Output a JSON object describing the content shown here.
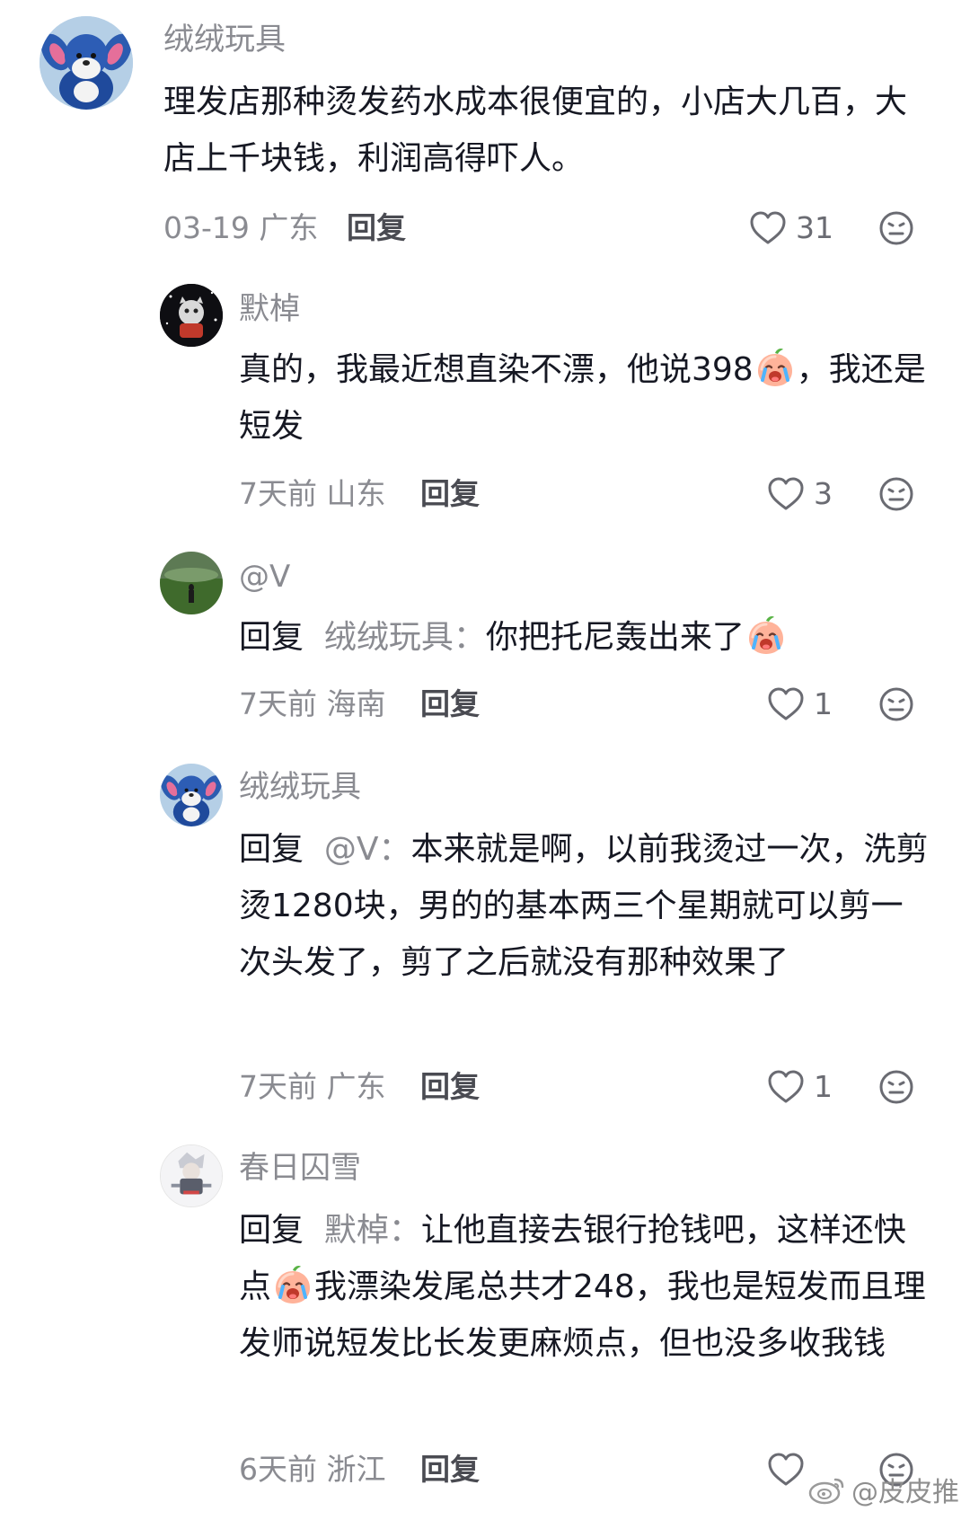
{
  "comments": [
    {
      "user": "绒绒玩具",
      "text": "理发店那种烫发药水成本很便宜的，小店大几百，大店上千块钱，利润高得吓人。",
      "time": "03-19 广东",
      "reply_label": "回复",
      "likes": "31"
    },
    {
      "user": "默棹",
      "text_a": "真的，我最近想直染不漂，他说398",
      "text_b": "，我还是短发",
      "time": "7天前 山东",
      "reply_label": "回复",
      "likes": "3"
    },
    {
      "user": "@V",
      "reply_prefix": "回复",
      "reply_target": "绒绒玩具：",
      "text": "你把托尼轰出来了",
      "time": "7天前 海南",
      "reply_label": "回复",
      "likes": "1"
    },
    {
      "user": "绒绒玩具",
      "reply_prefix": "回复",
      "reply_target": "@V：",
      "text": "本来就是啊，以前我烫过一次，洗剪烫1280块，男的的基本两三个星期就可以剪一次头发了，剪了之后就没有那种效果了",
      "time": "7天前 广东",
      "reply_label": "回复",
      "likes": "1"
    },
    {
      "user": "春日囚雪",
      "reply_prefix": "回复",
      "reply_target": "默棹：",
      "text_a": "让他直接去银行抢钱吧，这样还快点",
      "text_b": "我漂染发尾总共才248，我也是短发而且理发师说短发比长发更麻烦点，但也没多收我钱",
      "time": "6天前 浙江",
      "reply_label": "回复",
      "likes": ""
    }
  ],
  "watermark": "@皮皮推",
  "icons": {
    "like": "heart-outline-icon",
    "dislike": "neutral-face-icon",
    "emoji": "crying-peach-emoji",
    "watermark": "weibo-logo-icon"
  }
}
